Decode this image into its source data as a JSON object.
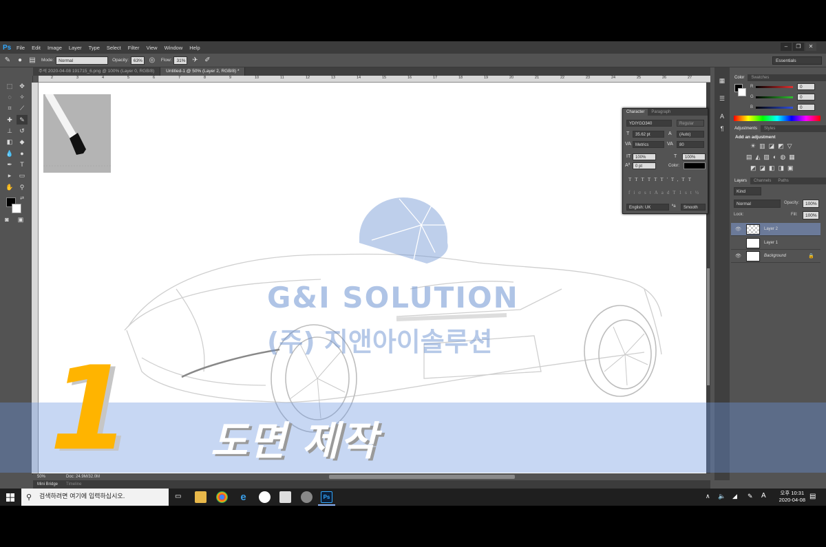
{
  "app": {
    "logo": "Ps",
    "menu": [
      "File",
      "Edit",
      "Image",
      "Layer",
      "Type",
      "Select",
      "Filter",
      "View",
      "Window",
      "Help"
    ],
    "workspace": "Essentials"
  },
  "options": {
    "mode_label": "Mode:",
    "mode_value": "Normal",
    "opacity_label": "Opacity:",
    "opacity_value": "63%",
    "flow_label": "Flow:",
    "flow_value": "31%"
  },
  "tabs": [
    {
      "label": "주석 2020-04-08 191715_6.png @ 100% (Layer 0, RGB/8)",
      "active": false
    },
    {
      "label": "Untitled-1 @ 50% (Layer 2, RGB/8) *",
      "active": true
    }
  ],
  "ruler_ticks": [
    "2",
    "3",
    "4",
    "5",
    "6",
    "7",
    "8",
    "9",
    "10",
    "11",
    "12",
    "13",
    "14",
    "15",
    "16",
    "17",
    "18",
    "19",
    "20",
    "21",
    "22",
    "23",
    "24",
    "25",
    "26",
    "27"
  ],
  "status": {
    "zoom": "50%",
    "doc": "Doc: 24.9M/32.0M"
  },
  "bottom_tabs": [
    "Mini Bridge",
    "Timeline"
  ],
  "color_panel": {
    "tabs": [
      "Color",
      "Swatches"
    ],
    "channels": [
      {
        "name": "R",
        "value": "0",
        "color": "#e03030"
      },
      {
        "name": "G",
        "value": "0",
        "color": "#30c030"
      },
      {
        "name": "B",
        "value": "0",
        "color": "#3050e0"
      }
    ]
  },
  "adjustments_panel": {
    "tabs": [
      "Adjustments",
      "Styles"
    ],
    "heading": "Add an adjustment"
  },
  "layers_panel": {
    "tabs": [
      "Layers",
      "Channels",
      "Paths"
    ],
    "kind": "Kind",
    "blend": "Normal",
    "opacity_label": "Opacity:",
    "opacity_value": "100%",
    "lock_label": "Lock:",
    "fill_label": "Fill:",
    "fill_value": "100%",
    "layers": [
      {
        "name": "Layer 2",
        "selected": true
      },
      {
        "name": "Layer 1",
        "selected": false
      },
      {
        "name": "Background",
        "selected": false
      }
    ]
  },
  "character_panel": {
    "tabs": [
      "Character",
      "Paragraph"
    ],
    "font": "YDIYGO340",
    "style": "Regular",
    "size": "35.62 pt",
    "leading": "(Auto)",
    "kerning": "Metrics",
    "tracking": "80",
    "vscale": "100%",
    "hscale": "100%",
    "baseline": "0 pt",
    "color_label": "Color:",
    "language": "English: UK",
    "antialias": "Smooth"
  },
  "watermark": {
    "en": "G&I SOLUTION",
    "ko": "(주) 지앤아이솔루션"
  },
  "overlay": {
    "number": "1",
    "title": "도면 제작"
  },
  "taskbar": {
    "search_placeholder": "검색하려면 여기에 입력하십시오.",
    "time_ampm": "오후 10:31",
    "date": "2020-04-08"
  }
}
